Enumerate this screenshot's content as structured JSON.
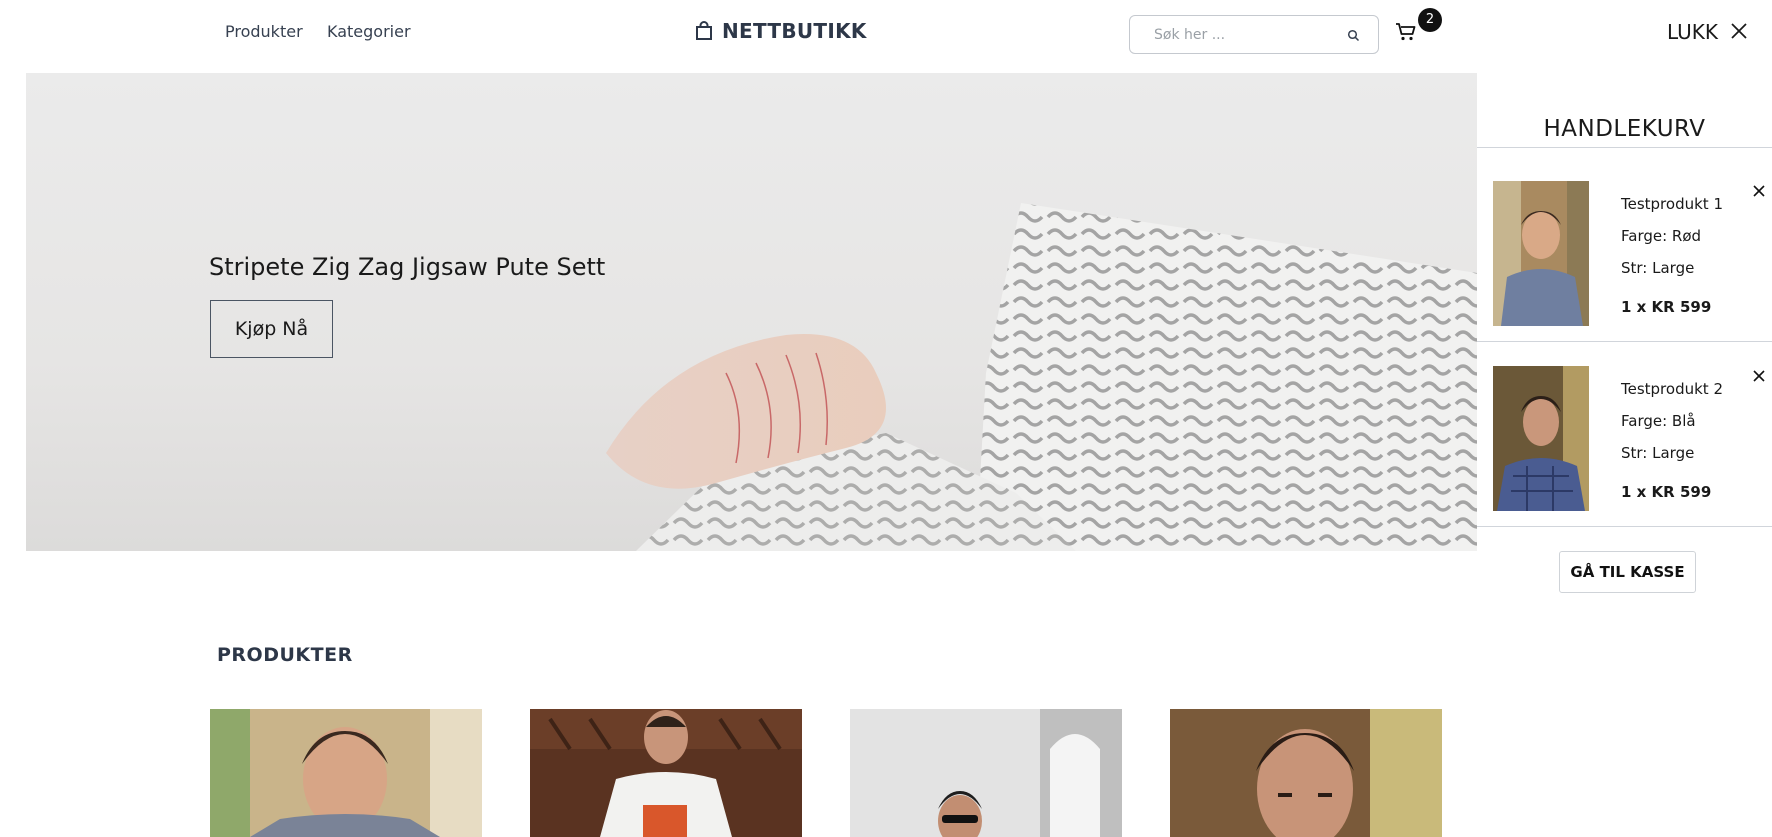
{
  "header": {
    "nav_products": "Produkter",
    "nav_categories": "Kategorier",
    "logo_text": "NETTBUTIKK",
    "search_placeholder": "Søk her ...",
    "cart_count": "2"
  },
  "hero": {
    "title": "Stripete Zig Zag Jigsaw Pute Sett",
    "button": "Kjøp Nå"
  },
  "cart_drawer": {
    "close_label": "LUKK",
    "title": "HANDLEKURV",
    "items": [
      {
        "name": "Testprodukt 1",
        "color": "Farge: Rød",
        "size": "Str: Large",
        "price": "1 x KR 599"
      },
      {
        "name": "Testprodukt 2",
        "color": "Farge: Blå",
        "size": "Str: Large",
        "price": "1 x KR 599"
      }
    ],
    "checkout_button": "GÅ TIL KASSE"
  },
  "products_section": {
    "title": "PRODUKTER"
  },
  "icons": {
    "logo": "shopping-bag-icon",
    "search": "search-icon",
    "cart": "cart-icon",
    "close": "close-icon",
    "remove": "remove-icon"
  }
}
